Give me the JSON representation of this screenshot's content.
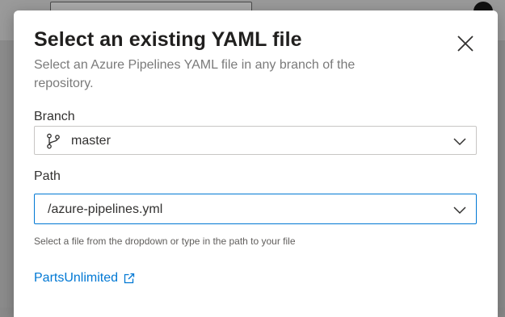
{
  "dialog": {
    "title": "Select an existing YAML file",
    "subtitle": "Select an Azure Pipelines YAML file in any branch of the repository."
  },
  "branch": {
    "label": "Branch",
    "value": "master",
    "icon": "branch-icon"
  },
  "path": {
    "label": "Path",
    "value": "/azure-pipelines.yml",
    "helper": "Select a file from the dropdown or type in the path to your file"
  },
  "repository": {
    "link_label": "PartsUnlimited",
    "icon": "external-link-icon"
  },
  "colors": {
    "accent": "#0078d4",
    "text": "#323130",
    "muted": "#7a7a7a",
    "overlay": "#8c8c8c"
  }
}
